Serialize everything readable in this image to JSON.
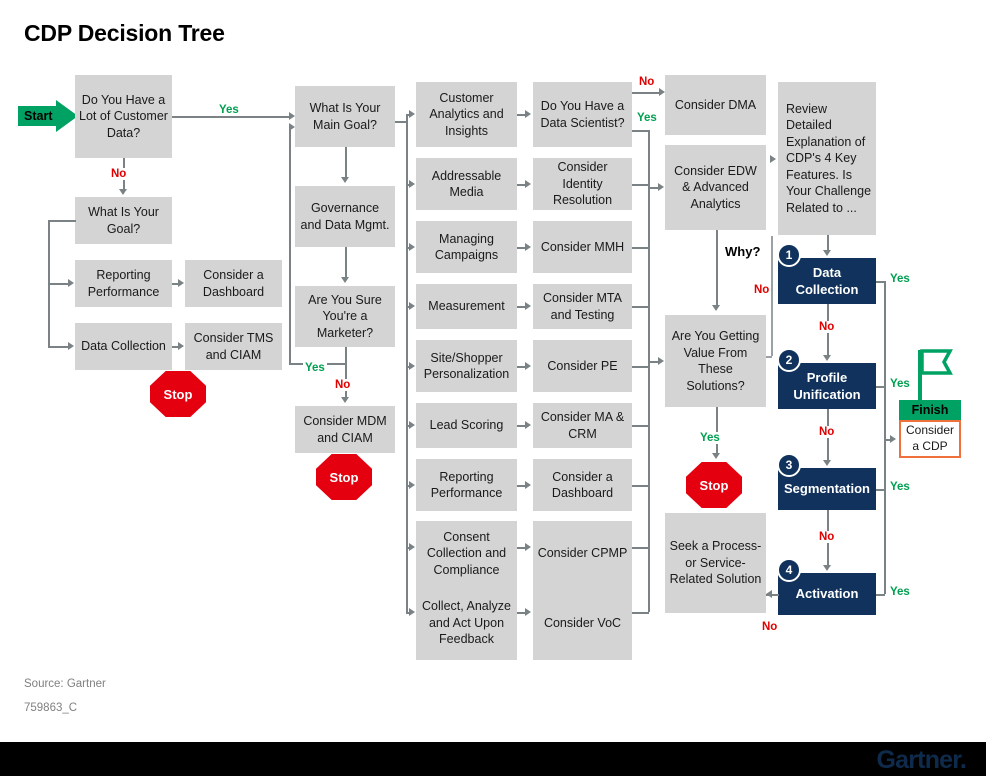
{
  "title": "CDP Decision Tree",
  "footer": {
    "source": "Source: Gartner",
    "code": "759863_C",
    "logo": "Gartner"
  },
  "colors": {
    "grey_box": "#d4d4d4",
    "navy_box": "#10325c",
    "green": "#00a263",
    "red": "#e4000f",
    "orange": "#f0703c",
    "connector": "#7a8285"
  },
  "markers": {
    "start": "Start",
    "stop": "Stop",
    "finish": "Finish"
  },
  "labels": {
    "yes": "Yes",
    "no": "No",
    "why": "Why?"
  },
  "nodes": {
    "n1": "Do You Have a Lot of Customer Data?",
    "n2": "What Is Your Goal?",
    "n3": "Reporting Performance",
    "n4": "Consider a Dashboard",
    "n5": "Data Collection",
    "n6": "Consider TMS and CIAM",
    "n7": "What Is Your Main Goal?",
    "n8": "Governance and Data Mgmt.",
    "n9": "Are You Sure You're a Marketer?",
    "n10": "Consider MDM and CIAM",
    "n11": "Customer Analytics and Insights",
    "n12": "Addressable Media",
    "n13": "Managing Campaigns",
    "n14": "Measurement",
    "n15": "Site/Shopper Personalization",
    "n16": "Lead Scoring",
    "n17": "Reporting Performance",
    "n18": "Consent Collection and Compliance",
    "n19": "Collect, Analyze and Act Upon Feedback",
    "n20": "Do You Have a Data Scientist?",
    "n21": "Consider Identity Resolution",
    "n22": "Consider MMH",
    "n23": "Consider MTA and Testing",
    "n24": "Consider PE",
    "n25": "Consider MA & CRM",
    "n26": "Consider a Dashboard",
    "n27": "Consider CPMP",
    "n28": "Consider VoC",
    "n29": "Consider DMA",
    "n30": "Consider EDW & Advanced Analytics",
    "n31": "Are You Getting Value From These Solutions?",
    "n32": "Seek a Process- or Service-Related Solution",
    "n33": "Review Detailed Explanation of CDP's 4 Key Features. Is Your Challenge Related to ...",
    "n34": "Data Collection",
    "n35": "Profile Unification",
    "n36": "Segmentation",
    "n37": "Activation",
    "n38": "Consider a CDP"
  },
  "stepnumbers": {
    "s1": "1",
    "s2": "2",
    "s3": "3",
    "s4": "4"
  }
}
